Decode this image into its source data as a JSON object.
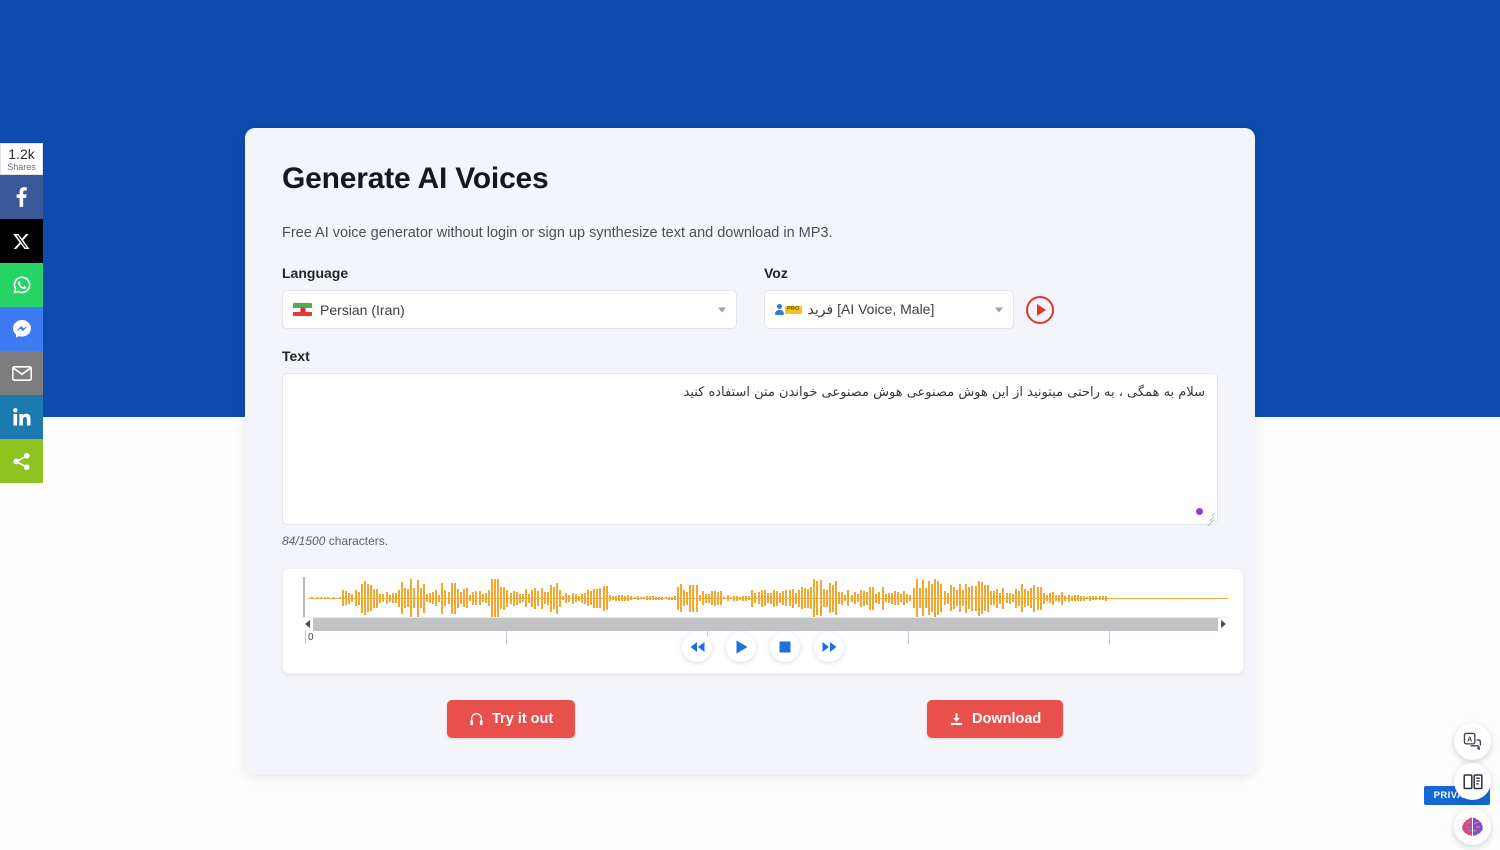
{
  "page": {
    "background_blue": "#0d4bae",
    "card_background": "#f4f5fa",
    "accent_red": "#e8514b",
    "accent_orange": "#f0a830",
    "accent_blue": "#1f6fe0"
  },
  "card": {
    "title": "Generate AI Voices",
    "subtitle": "Free AI voice generator without login or sign up synthesize text and download in MP3."
  },
  "language_field": {
    "label": "Language",
    "selected": "Persian (Iran)",
    "flag": "iran-flag-icon",
    "caret": "chevron-down-icon"
  },
  "voice_field": {
    "label": "Voz",
    "badge": "PRO",
    "selected": "فرید [AI Voice, Male]",
    "person_icon": "person-icon",
    "caret": "chevron-down-icon",
    "preview_button": "play-preview-icon"
  },
  "text_field": {
    "label": "Text",
    "value": "سلام به همگی ، به راحتی میتونید از این هوش مصنوعی هوش مصنوعی خواندن متن استفاده کنید",
    "count_used": "84/1500",
    "count_suffix": " characters.",
    "resize_handle": "resize-handle-icon",
    "status_dot": "status-dot-icon"
  },
  "player": {
    "timeline_zero": "0",
    "controls": [
      {
        "name": "rewind-button",
        "icon": "rewind-icon"
      },
      {
        "name": "play-button",
        "icon": "play-icon"
      },
      {
        "name": "stop-button",
        "icon": "stop-icon"
      },
      {
        "name": "forward-button",
        "icon": "forward-icon"
      }
    ],
    "waveform_color": "#f0a830"
  },
  "actions": {
    "try_label": "Try it out",
    "try_icon": "headphones-icon",
    "download_label": "Download",
    "download_icon": "download-icon"
  },
  "share_rail": {
    "count": "1.2k",
    "count_label": "Shares",
    "items": [
      {
        "name": "share-facebook",
        "icon": "facebook-icon",
        "color": "#3b5998"
      },
      {
        "name": "share-x",
        "icon": "x-twitter-icon",
        "color": "#000000"
      },
      {
        "name": "share-whatsapp",
        "icon": "whatsapp-icon",
        "color": "#25d366"
      },
      {
        "name": "share-messenger",
        "icon": "messenger-icon",
        "color": "#3d7bf4"
      },
      {
        "name": "share-email",
        "icon": "email-icon",
        "color": "#7d7d7d"
      },
      {
        "name": "share-linkedin",
        "icon": "linkedin-icon",
        "color": "#1c7ab0"
      },
      {
        "name": "share-more",
        "icon": "share-nodes-icon",
        "color": "#8fc31f"
      }
    ]
  },
  "floating": {
    "translate_icon": "translate-icon",
    "reader_icon": "book-reader-icon",
    "brain_icon": "brain-icon",
    "privacy_label": "PRIVACY"
  }
}
